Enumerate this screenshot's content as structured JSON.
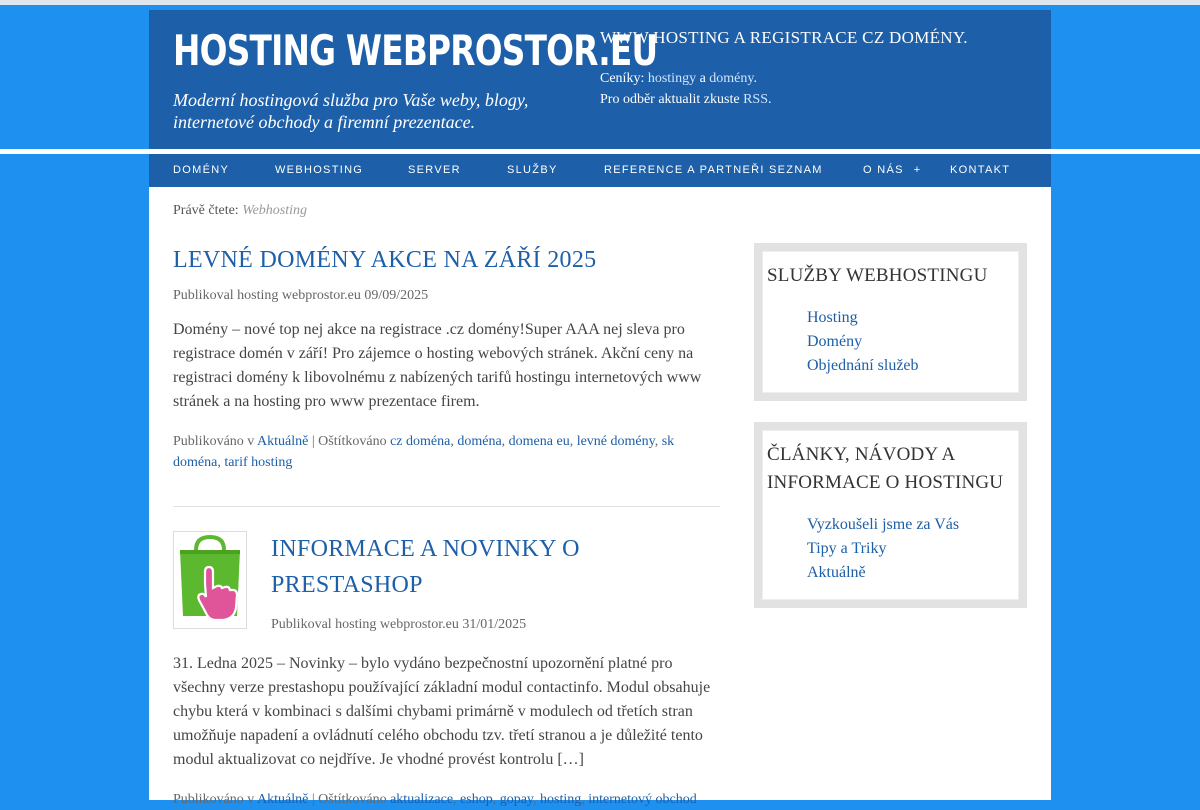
{
  "header": {
    "site_title": "HOSTING WEBPROSTOR.EU",
    "tagline": "Moderní hostingová služba pro Vaše weby, blogy, internetové obchody a firemní prezentace.",
    "right_title": "WWW HOSTING A REGISTRACE CZ DOMÉNY.",
    "prices_prefix": "Ceníky: ",
    "prices_link1": "hostingy",
    "prices_and": " a ",
    "prices_link2": "domény",
    "prices_end": ".",
    "rss_prefix": "Pro odběr aktualit zkuste ",
    "rss_link": "RSS",
    "rss_end": "."
  },
  "nav": {
    "items": [
      "Domény",
      "Webhosting",
      "Server",
      "Služby",
      "Reference a partneři seznam",
      "O nás",
      "Kontakt"
    ],
    "plus": "+"
  },
  "breadcrumb": {
    "label": "Právě čtete: ",
    "current": "Webhosting"
  },
  "posts": [
    {
      "title": "LEVNÉ DOMÉNY AKCE NA ZÁŘÍ 2025",
      "meta": "Publikoval hosting webprostor.eu 09/09/2025",
      "excerpt": "Domény – nové top nej akce na registrace .cz domény!Super AAA nej sleva pro registrace domén v září! Pro zájemce o hosting webových stránek. Akční ceny na registraci domény k libovolnému z nabízených tarifů hostingu internetových www stránek a na hosting pro www prezentace firem.",
      "category_prefix": "Publikováno v ",
      "category": "Aktuálně",
      "tags_prefix": " | Oštítkováno ",
      "tags": [
        "cz doména",
        "doména",
        "domena eu",
        "levné domény",
        "sk doména",
        "tarif hosting"
      ]
    },
    {
      "title": "INFORMACE A NOVINKY O PRESTASHOP",
      "meta": "Publikoval hosting webprostor.eu 31/01/2025",
      "excerpt": "31. Ledna 2025 – Novinky – bylo vydáno bezpečnostní upozornění platné pro všechny verze prestashopu používající základní modul contactinfo. Modul obsahuje chybu která v kombinaci s dalšími chybami primárně v modulech od třetích stran umožňuje napadení a ovládnutí celého obchodu tzv. třetí stranou a je důležité tento modul aktualizovat co nejdříve. Je vhodné provést kontrolu […]",
      "category_prefix": "Publikováno v ",
      "category": "Aktuálně",
      "tags_prefix": " | Oštítkováno ",
      "tags": [
        "aktualizace",
        "eshop",
        "gopay",
        "hosting",
        "internetový obchod"
      ]
    }
  ],
  "sidebar": {
    "widget1": {
      "title": "SLUŽBY WEBHOSTINGU",
      "links": [
        "Hosting",
        "Domény",
        "Objednání služeb"
      ]
    },
    "widget2": {
      "title": "ČLÁNKY, NÁVODY A INFORMACE O HOSTINGU",
      "links": [
        "Vyzkoušeli jsme za Vás",
        "Tipy a Triky",
        "Aktuálně"
      ]
    }
  },
  "icons": {
    "thumbnail": "shopping-bag-hand-icon"
  },
  "colors": {
    "brand": "#1d5fa8",
    "background": "#1e90f0",
    "bag": "#5cb82e",
    "hand": "#e0559a"
  }
}
